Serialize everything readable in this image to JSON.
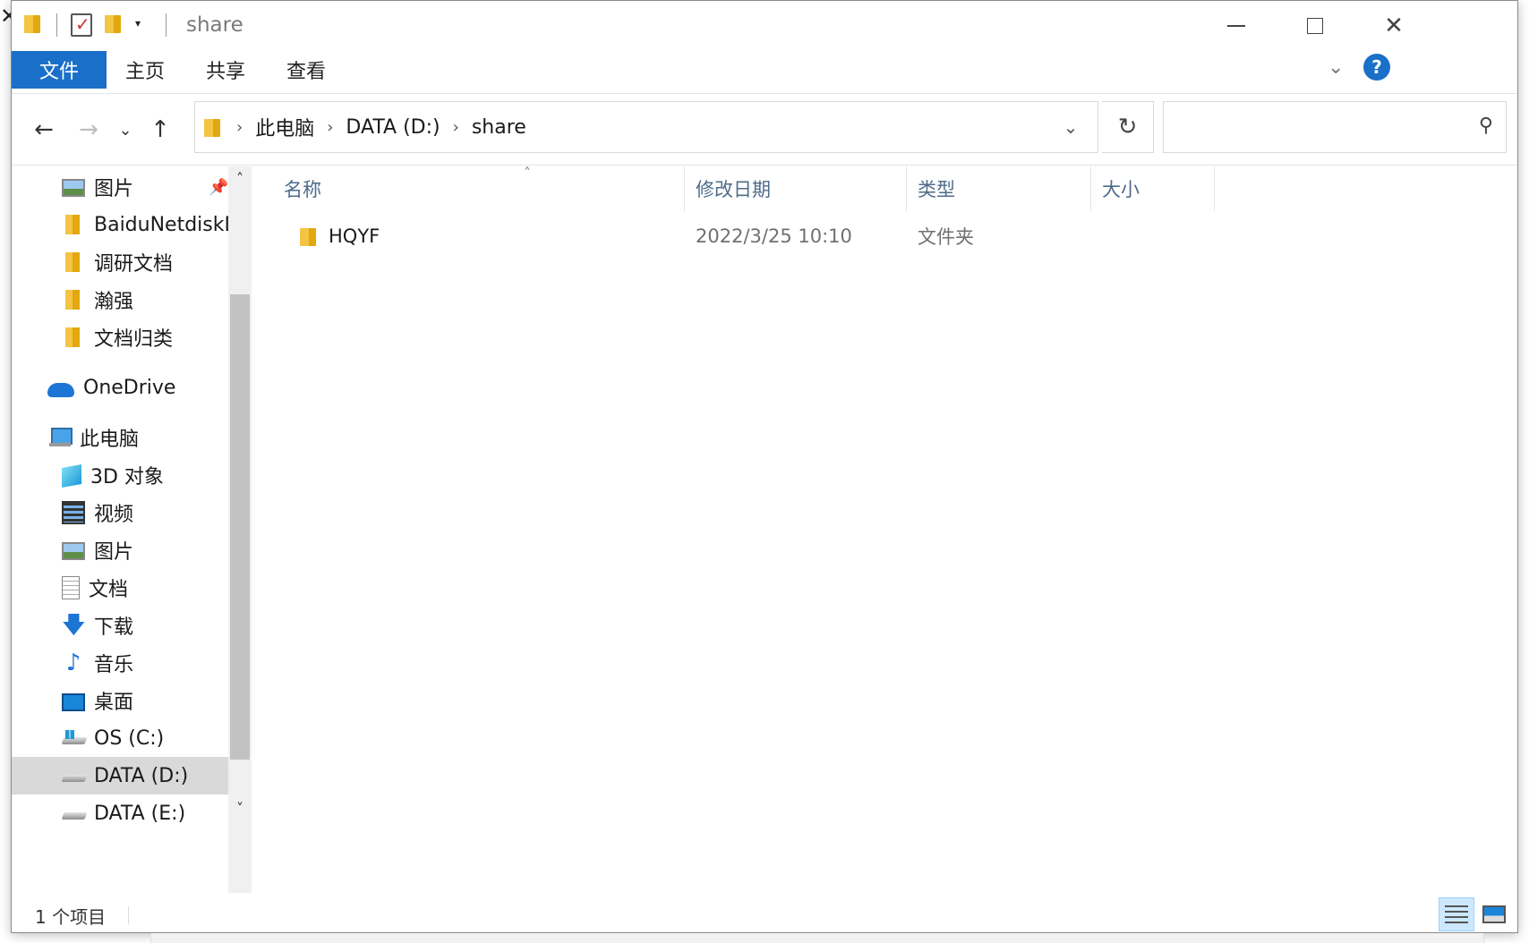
{
  "window": {
    "title": "share",
    "edge_close_glyph": "✕",
    "controls": {
      "minimize": "—",
      "maximize": "☐",
      "close": "✕"
    }
  },
  "ribbon": {
    "tabs": [
      {
        "label": "文件",
        "active": true
      },
      {
        "label": "主页"
      },
      {
        "label": "共享"
      },
      {
        "label": "查看"
      }
    ],
    "help_label": "?",
    "collapse_glyph": "⌄"
  },
  "nav": {
    "back": "←",
    "forward": "→",
    "recent": "⌄",
    "up": "↑",
    "breadcrumb": [
      "此电脑",
      "DATA (D:)",
      "share"
    ],
    "breadcrumb_sep": "›",
    "address_dropdown": "⌄",
    "refresh": "↻",
    "search": {
      "value": "",
      "placeholder": "",
      "icon": "⚲"
    }
  },
  "sidebar": {
    "items": [
      {
        "label": "图片",
        "icon": "pictures-icon",
        "pinned": true
      },
      {
        "label": "BaiduNetdiskDownload",
        "icon": "folder-icon"
      },
      {
        "label": "调研文档",
        "icon": "folder-icon"
      },
      {
        "label": "瀚强",
        "icon": "folder-icon"
      },
      {
        "label": "文档归类",
        "icon": "folder-icon"
      },
      {
        "label": "OneDrive",
        "icon": "onedrive-icon"
      },
      {
        "label": "此电脑",
        "icon": "computer-icon"
      },
      {
        "label": "3D 对象",
        "icon": "3d-objects-icon"
      },
      {
        "label": "视频",
        "icon": "video-icon"
      },
      {
        "label": "图片",
        "icon": "pictures-icon"
      },
      {
        "label": "文档",
        "icon": "document-icon"
      },
      {
        "label": "下载",
        "icon": "download-icon"
      },
      {
        "label": "音乐",
        "icon": "music-icon"
      },
      {
        "label": "桌面",
        "icon": "desktop-icon"
      },
      {
        "label": "OS (C:)",
        "icon": "windows-drive-icon"
      },
      {
        "label": "DATA (D:)",
        "icon": "drive-icon",
        "selected": true
      },
      {
        "label": "DATA (E:)",
        "icon": "drive-icon"
      }
    ],
    "pin_glyph": "📌",
    "download_glyph": "🡇",
    "music_glyph": "♪",
    "scroll_up": "˄",
    "scroll_down": "˅"
  },
  "files": {
    "columns": [
      "名称",
      "修改日期",
      "类型",
      "大小"
    ],
    "sort_glyph": "˄",
    "rows": [
      {
        "name": "HQYF",
        "modified": "2022/3/25 10:10",
        "type": "文件夹",
        "size": ""
      }
    ]
  },
  "status": {
    "item_count": "1 个项目"
  },
  "colors": {
    "accent": "#1a6fc8",
    "selected": "#d9d9d9",
    "header_text": "#4d6b8a"
  }
}
